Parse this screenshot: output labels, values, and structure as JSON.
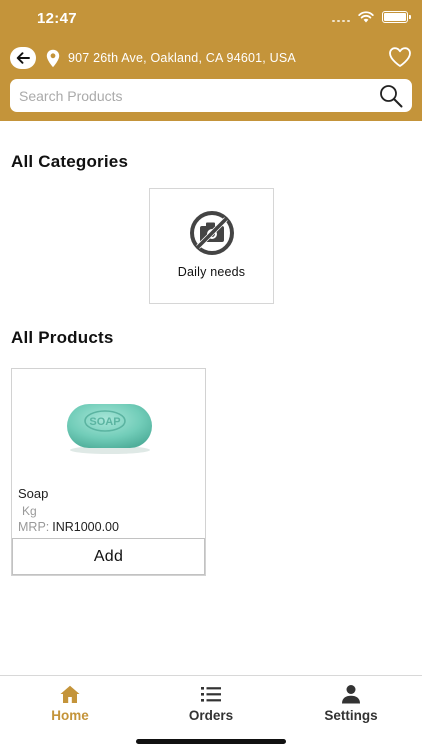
{
  "status_bar": {
    "time": "12:47"
  },
  "header": {
    "address": "907 26th Ave, Oakland, CA 94601, USA",
    "icons": [
      "back-arrow-icon",
      "location-pin-icon",
      "heart-icon"
    ]
  },
  "search": {
    "placeholder": "Search Products",
    "value": ""
  },
  "categories": {
    "title": "All Categories",
    "items": [
      {
        "label": "Daily needs",
        "icon": "no-photo-icon"
      }
    ]
  },
  "products": {
    "title": "All Products",
    "items": [
      {
        "name": "Soap",
        "unit": "Kg",
        "mrp_label": "MRP:",
        "price": "INR1000.00",
        "add_label": "Add",
        "image_text": "SOAP"
      }
    ]
  },
  "tabs": [
    {
      "label": "Home",
      "icon": "home-icon",
      "active": true
    },
    {
      "label": "Orders",
      "icon": "list-icon",
      "active": false
    },
    {
      "label": "Settings",
      "icon": "person-icon",
      "active": false
    }
  ],
  "colors": {
    "brand": "#c4943a",
    "active_tab": "#c4943a"
  }
}
